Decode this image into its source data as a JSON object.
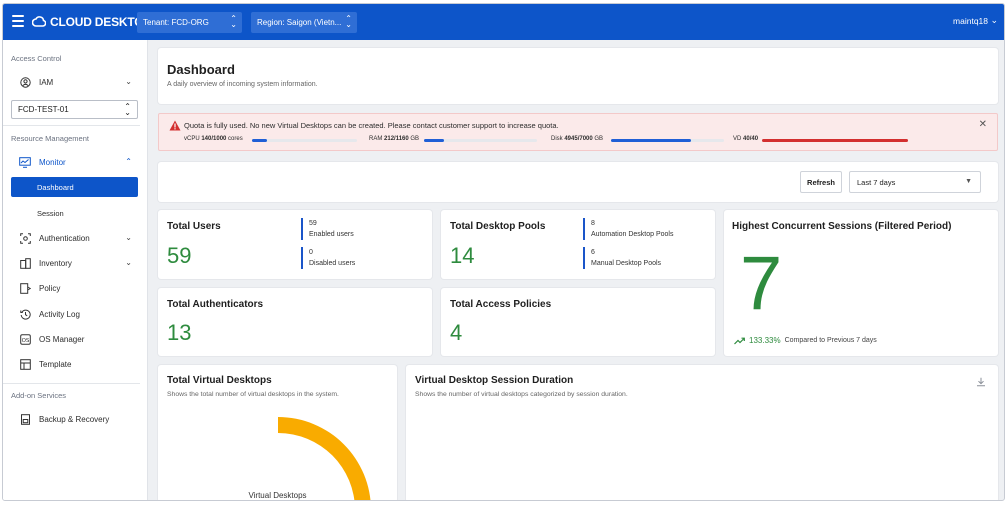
{
  "app": {
    "brand": "CLOUD DESKTOP",
    "tenant": "Tenant: FCD-ORG",
    "region": "Region: Saigon (Vietn...",
    "user": "maintq18"
  },
  "sidebar": {
    "section_access": "Access Control",
    "iam": "IAM",
    "tenant_select": "FCD-TEST-01",
    "section_resource": "Resource Management",
    "monitor": "Monitor",
    "dashboard": "Dashboard",
    "session": "Session",
    "authentication": "Authentication",
    "inventory": "Inventory",
    "policy": "Policy",
    "activity_log": "Activity Log",
    "os_manager": "OS Manager",
    "template": "Template",
    "section_addon": "Add-on Services",
    "backup": "Backup & Recovery"
  },
  "header": {
    "title": "Dashboard",
    "subtitle": "A daily overview of incoming system information."
  },
  "alert": {
    "message": "Quota is fully used. No new Virtual Desktops can be created. Please contact customer support to increase quota.",
    "quotas": [
      {
        "label": "vCPU",
        "value": "140/1000",
        "unit": "cores",
        "fraction": 0.14,
        "color": "#1f5fd6"
      },
      {
        "label": "RAM",
        "value": "212/1160",
        "unit": "GB",
        "fraction": 0.18,
        "color": "#1f5fd6"
      },
      {
        "label": "Disk",
        "value": "4945/7000",
        "unit": "GB",
        "fraction": 0.71,
        "color": "#1f5fd6"
      },
      {
        "label": "VD",
        "value": "40/40",
        "unit": "",
        "fraction": 1.0,
        "color": "#d32f2f"
      }
    ]
  },
  "toolbar": {
    "refresh": "Refresh",
    "range": "Last 7 days"
  },
  "stats": {
    "total_users": {
      "title": "Total Users",
      "value": "59",
      "enabled_count": "59",
      "enabled_label": "Enabled users",
      "disabled_count": "0",
      "disabled_label": "Disabled users"
    },
    "total_pools": {
      "title": "Total Desktop Pools",
      "value": "14",
      "auto_count": "8",
      "auto_label": "Automation Desktop Pools",
      "manual_count": "6",
      "manual_label": "Manual Desktop Pools"
    },
    "concurrent": {
      "title": "Highest Concurrent Sessions (Filtered Period)",
      "value": "7",
      "pct": "133.33%",
      "compare": "Compared to Previous 7 days"
    },
    "authenticators": {
      "title": "Total Authenticators",
      "value": "13"
    },
    "policies": {
      "title": "Total Access Policies",
      "value": "4"
    }
  },
  "charts": {
    "vd": {
      "title": "Total Virtual Desktops",
      "desc": "Shows the total number of virtual desktops in the system.",
      "center_label": "Virtual Desktops",
      "color": "#f9ab00"
    },
    "duration": {
      "title": "Virtual Desktop Session Duration",
      "desc": "Shows the number of virtual desktops categorized by session duration."
    }
  }
}
